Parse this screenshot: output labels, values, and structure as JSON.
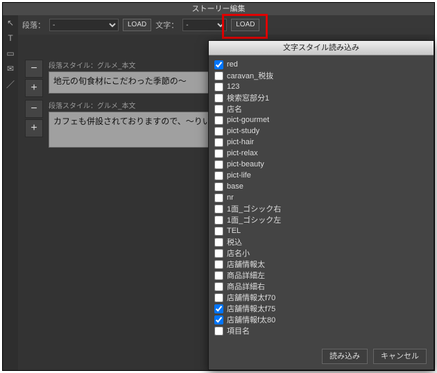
{
  "window_title": "ストーリー編集",
  "toolbar": {
    "para_label": "段落：",
    "para_sel": "-",
    "para_load": "LOAD",
    "char_label": "文字：",
    "char_sel": "-",
    "char_load": "LOAD"
  },
  "rail_icons": [
    "cursor",
    "T",
    "rect",
    "mail",
    "line"
  ],
  "blocks": [
    {
      "style_label": "段落スタイル：グルメ_本文",
      "text": "地元の旬食材にこだわった季節の～"
    },
    {
      "style_label": "段落スタイル：グルメ_本文",
      "text": "カフェも併設されておりますので、～りいただけます。"
    }
  ],
  "modal": {
    "title": "文字スタイル読み込み",
    "items": [
      {
        "label": "red",
        "checked": true
      },
      {
        "label": "caravan_税抜",
        "checked": false
      },
      {
        "label": "123",
        "checked": false
      },
      {
        "label": "検索窓部分1",
        "checked": false
      },
      {
        "label": "店名",
        "checked": false
      },
      {
        "label": "pict-gourmet",
        "checked": false
      },
      {
        "label": "pict-study",
        "checked": false
      },
      {
        "label": "pict-hair",
        "checked": false
      },
      {
        "label": "pict-relax",
        "checked": false
      },
      {
        "label": "pict-beauty",
        "checked": false
      },
      {
        "label": "pict-life",
        "checked": false
      },
      {
        "label": "base",
        "checked": false
      },
      {
        "label": "nr",
        "checked": false
      },
      {
        "label": "1面_ゴシック右",
        "checked": false
      },
      {
        "label": "1面_ゴシック左",
        "checked": false
      },
      {
        "label": "TEL",
        "checked": false
      },
      {
        "label": "税込",
        "checked": false
      },
      {
        "label": "店名小",
        "checked": false
      },
      {
        "label": "店舗情報太",
        "checked": false
      },
      {
        "label": "商品詳細左",
        "checked": false
      },
      {
        "label": "商品詳細右",
        "checked": false
      },
      {
        "label": "店舗情報太f70",
        "checked": false
      },
      {
        "label": "店舗情報太f75",
        "checked": true
      },
      {
        "label": "店舗情報f太80",
        "checked": true
      },
      {
        "label": "項目名",
        "checked": false
      }
    ],
    "ok": "読み込み",
    "cancel": "キャンセル"
  }
}
